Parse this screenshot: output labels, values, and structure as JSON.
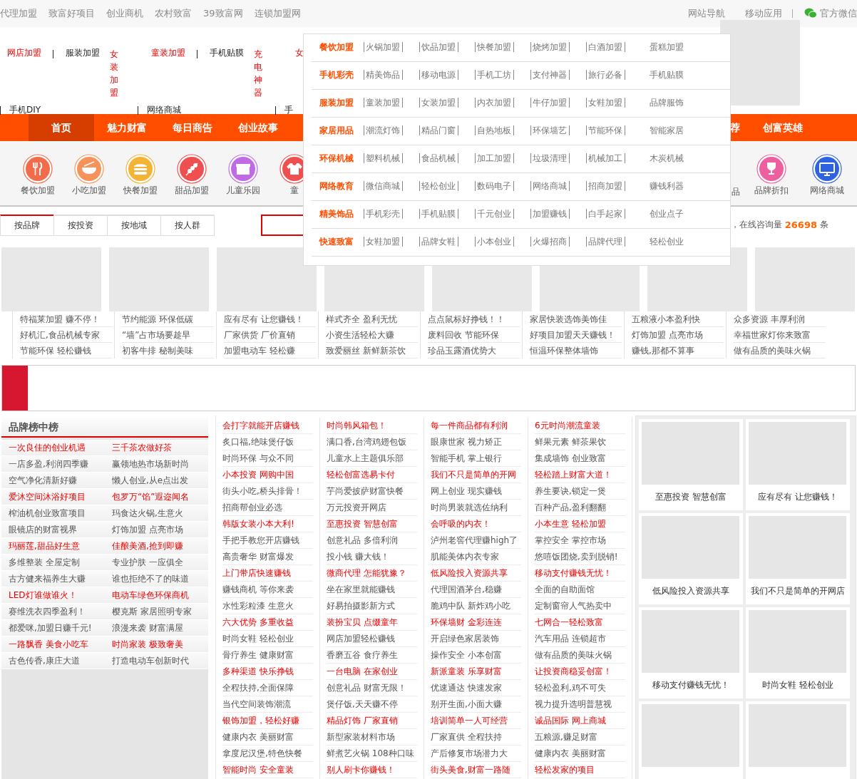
{
  "top_bar": {
    "links": [
      "代理加盟",
      "致富好项目",
      "创业商机",
      "农村致富",
      "39致富网",
      "连锁加盟网"
    ],
    "right_links": [
      "网站导航",
      "移动应用"
    ],
    "wechat": "官方微信"
  },
  "header": {
    "row1": [
      {
        "label": "网店加盟",
        "highlighted": true,
        "kind": "text",
        "divider_before": false
      },
      {
        "label": "服装加盟",
        "highlighted": false,
        "kind": "text",
        "divider_before": true
      },
      {
        "label": "女装加盟",
        "highlighted": true,
        "kind": "vertical",
        "divider_before": false
      },
      {
        "label": "童装加盟",
        "highlighted": true,
        "kind": "text",
        "divider_before": false
      },
      {
        "label": "手机贴膜",
        "highlighted": false,
        "kind": "text",
        "divider_before": true
      },
      {
        "label": "充电神器",
        "highlighted": true,
        "kind": "vertical",
        "divider_before": false
      },
      {
        "label": "女",
        "highlighted": true,
        "kind": "text",
        "divider_before": false
      }
    ],
    "row2": [
      "手机DIY",
      "网络商城",
      "手"
    ]
  },
  "nav": {
    "left": [
      {
        "label": "首页",
        "selected": true
      },
      {
        "label": "魅力财富",
        "selected": false
      },
      {
        "label": "每日商告",
        "selected": false
      },
      {
        "label": "创业故事",
        "selected": false
      }
    ],
    "right": [
      {
        "label": "荐",
        "selected": false
      },
      {
        "label": "创富英雄",
        "selected": false
      }
    ]
  },
  "category_icons": {
    "left": [
      {
        "label": "餐饮加盟",
        "color": "#f26b4a"
      },
      {
        "label": "小吃加盟",
        "color": "#f7935a"
      },
      {
        "label": "快餐加盟",
        "color": "#f5b335"
      },
      {
        "label": "甜品加盟",
        "color": "#ef4f4f"
      },
      {
        "label": "儿童乐园",
        "color": "#c06ae6"
      },
      {
        "label": "童",
        "color": "#ef4f4f"
      }
    ],
    "right": [
      {
        "label": "品"
      },
      {
        "label": "品牌折扣",
        "color": "#ee5fa0"
      },
      {
        "label": "网络商城",
        "color": "#2f62e0"
      }
    ]
  },
  "dropdown": {
    "rows": [
      {
        "title": "餐饮加盟",
        "items": [
          "火锅加盟",
          "饮品加盟",
          "快餐加盟",
          "烧烤加盟",
          "白酒加盟",
          "蛋糕加盟"
        ]
      },
      {
        "title": "手机彩壳",
        "items": [
          "精美饰品",
          "移动电源",
          "手机工坊",
          "支付神器",
          "旅行必备",
          "手机贴膜"
        ]
      },
      {
        "title": "服装加盟",
        "items": [
          "童装加盟",
          "女装加盟",
          "内衣加盟",
          "牛仔加盟",
          "女鞋加盟",
          "品牌服饰"
        ]
      },
      {
        "title": "家居用品",
        "items": [
          "潮流灯饰",
          "精品门窗",
          "自热地板",
          "环保墙艺",
          "节能环保",
          "智能家居"
        ]
      },
      {
        "title": "环保机械",
        "items": [
          "塑料机械",
          "食品机械",
          "加工加盟",
          "垃圾清理",
          "机械加工",
          "木炭机械"
        ]
      },
      {
        "title": "网络教育",
        "items": [
          "微信商城",
          "轻松创业",
          "数码电子",
          "网络商城",
          "招商加盟",
          "赚钱利器"
        ]
      },
      {
        "title": "精美饰品",
        "items": [
          "手机彩壳",
          "手机贴膜",
          "千元创业",
          "加盟赚钱",
          "白手起家",
          "创业点子"
        ]
      },
      {
        "title": "快速致富",
        "items": [
          "女鞋加盟",
          "品牌女鞋",
          "小本创业",
          "火爆招商",
          "品牌代理",
          "轻松创业"
        ]
      }
    ]
  },
  "search_tabs": {
    "tabs": [
      {
        "label": "按品牌",
        "selected": true
      },
      {
        "label": "按投资",
        "selected": false
      },
      {
        "label": "按地域",
        "selected": false
      },
      {
        "label": "按人群",
        "selected": false
      }
    ],
    "stats": {
      "label": "，在线咨询量",
      "count": "26698",
      "unit": "条"
    }
  },
  "ads": [
    {
      "lines": [
        "特福莱加盟 赚不停！",
        "好机汇,食品机械专家",
        "节能环保 轻松赚钱"
      ]
    },
    {
      "lines": [
        "节约能源 环保低碳",
        "“墙”占市场要趁早",
        "初客牛排 秘制美味"
      ]
    },
    {
      "lines": [
        "应有尽有 让您赚钱！",
        "厂家供货 厂价直销",
        "加盟电动车 轻松赚"
      ]
    },
    {
      "lines": [
        "样式齐全 盈利无忧",
        "小资生活轻松大赚",
        "致爱丽丝 新鲜新茶饮"
      ]
    },
    {
      "lines": [
        "点点鼠标好挣钱！！",
        "废料回收 节能环保",
        "珍品玉露酒优势大"
      ]
    },
    {
      "lines": [
        "家居快装选饰美饰佳",
        "好项目加盟天天赚钱！",
        "恒温环保整体墙饰"
      ]
    },
    {
      "lines": [
        "五粮液小本盈利快",
        "灯饰加盟 点亮市场",
        "赚钱,那都不算事"
      ]
    },
    {
      "lines": [
        "众多资源 丰厚利润",
        "幸福世家灯你来致富",
        "做有品质的美味火锅"
      ]
    }
  ],
  "ranking": {
    "title": "**品牌**榜中榜",
    "rows": [
      {
        "highlighted": true,
        "cells": [
          "一次良佳的创业机遇",
          "三千茶农做好茶"
        ]
      },
      {
        "highlighted": false,
        "cells": [
          "一店多盈,利润四季赚",
          "赢领地热市场新时尚"
        ]
      },
      {
        "highlighted": false,
        "cells": [
          "空气净化清新好赚",
          "懒人创业,从e点出发"
        ]
      },
      {
        "highlighted": true,
        "cells": [
          "爱沐空间沐浴好项目",
          "包罗万“馅”遐迩闻名"
        ]
      },
      {
        "highlighted": false,
        "cells": [
          "榨油机创业致富项目",
          "玛食达火锅,生意火"
        ]
      },
      {
        "highlighted": false,
        "cells": [
          "眼镜店的财富视界",
          "灯饰加盟 点亮市场"
        ]
      },
      {
        "highlighted": true,
        "cells": [
          "玛丽莲,甜品好生意",
          "佳酿美酒,抢到即赚"
        ]
      },
      {
        "highlighted": false,
        "cells": [
          "多维整装 全屋定制",
          "专业护肤 一应俱全"
        ]
      },
      {
        "highlighted": false,
        "cells": [
          "古方健来福养生大赚",
          "谁也拒绝不了的味道"
        ]
      },
      {
        "highlighted": true,
        "cells": [
          "LED灯谁做谁火！",
          "电动车绿色环保商机"
        ]
      },
      {
        "highlighted": false,
        "cells": [
          "赛维洗衣四季盈利！",
          "樱克斯 家居照明专家"
        ]
      },
      {
        "highlighted": false,
        "cells": [
          "都爱咪,加盟日赚千元!",
          "浪漫来袭 财富满屋"
        ]
      },
      {
        "highlighted": true,
        "cells": [
          "一路飘香 美食小吃车",
          "时尚家装 极致奢美"
        ]
      },
      {
        "highlighted": false,
        "cells": [
          "古色传香,康庄大道",
          "打造电动车创新时代"
        ]
      }
    ]
  },
  "columns": [
    {
      "lines": [
        {
          "text": "会打字就能开店赚钱",
          "highlighted": true
        },
        {
          "text": "炙口福,绝味煲仔饭",
          "highlighted": false
        },
        {
          "text": "时尚环保 与众不同",
          "highlighted": false
        },
        {
          "text": "小本投资 网购中国",
          "highlighted": true
        },
        {
          "text": "街头小吃,桥头排骨！",
          "highlighted": false
        },
        {
          "text": "招商帮创业必选",
          "highlighted": false
        },
        {
          "text": "韩版女装小本大利!",
          "highlighted": true
        },
        {
          "text": "手把手教您开店赚钱",
          "highlighted": false
        },
        {
          "text": "高贵奢华 财富爆发",
          "highlighted": false
        },
        {
          "text": "上门带店快速赚钱",
          "highlighted": true
        },
        {
          "text": "赚钱商机 等你来袭",
          "highlighted": false
        },
        {
          "text": "水性彩粒漆 生意火",
          "highlighted": false
        },
        {
          "text": "六大优势 多重收益",
          "highlighted": true
        },
        {
          "text": "时尚女鞋 轻松创业",
          "highlighted": false
        },
        {
          "text": "骨疗养生 健康财富",
          "highlighted": false
        },
        {
          "text": "多种渠道 快乐挣钱",
          "highlighted": true
        },
        {
          "text": "全程扶持,全面保障",
          "highlighted": false
        },
        {
          "text": "当代空间装饰潮流",
          "highlighted": false
        },
        {
          "text": "银饰加盟，轻松好赚",
          "highlighted": true
        },
        {
          "text": "健康内衣 美丽财富",
          "highlighted": false
        },
        {
          "text": "拿度尼汉堡,特色快餐",
          "highlighted": false
        },
        {
          "text": "智能时尚 安全童装",
          "highlighted": true
        }
      ]
    },
    {
      "lines": [
        {
          "text": "时尚韩风箱包！",
          "highlighted": true
        },
        {
          "text": "满口香,台湾鸡翅包饭",
          "highlighted": false
        },
        {
          "text": "儿童水上主题俱乐部",
          "highlighted": false
        },
        {
          "text": "轻松创富选易卡付",
          "highlighted": true
        },
        {
          "text": "芋尚爱披萨财富快餐",
          "highlighted": false
        },
        {
          "text": "万元投资开网店",
          "highlighted": false
        },
        {
          "text": "至惠投资 智慧创富",
          "highlighted": true
        },
        {
          "text": "创意礼品 多倍利润",
          "highlighted": false
        },
        {
          "text": "投小钱 赚大钱！",
          "highlighted": false
        },
        {
          "text": "微商代理 怎能犹豫？",
          "highlighted": true
        },
        {
          "text": "坐在家里就能赚钱",
          "highlighted": false
        },
        {
          "text": "好易拍摄影新方式",
          "highlighted": false
        },
        {
          "text": "装扮宝贝 点缀童年",
          "highlighted": true
        },
        {
          "text": "网店加盟轻松赚钱",
          "highlighted": false
        },
        {
          "text": "香磨五谷 食疗养生",
          "highlighted": false
        },
        {
          "text": "一台电脑 在家创业",
          "highlighted": true
        },
        {
          "text": "创意礼品 财富无限！",
          "highlighted": false
        },
        {
          "text": "煲仔饭,天天赚不停",
          "highlighted": false
        },
        {
          "text": "精品灯饰 厂家直销",
          "highlighted": true
        },
        {
          "text": "新型家装材料市场",
          "highlighted": false
        },
        {
          "text": "鲜煮艺火锅 108种口味",
          "highlighted": false
        },
        {
          "text": "别人刷卡你赚钱！",
          "highlighted": true
        }
      ]
    },
    {
      "lines": [
        {
          "text": "每一件商品都有利润",
          "highlighted": true
        },
        {
          "text": "眼康世家 视力矫正",
          "highlighted": false
        },
        {
          "text": "智能手机 掌上银行",
          "highlighted": false
        },
        {
          "text": "我们不只是简单的开网",
          "highlighted": true
        },
        {
          "text": "网上创业 现实赚钱",
          "highlighted": false
        },
        {
          "text": "时尚男装就选佐纳利",
          "highlighted": false
        },
        {
          "text": "会呼吸的内衣！",
          "highlighted": true
        },
        {
          "text": "泸州老窖代理赚high了",
          "highlighted": false
        },
        {
          "text": "肌能美体内衣专家",
          "highlighted": false
        },
        {
          "text": "低风险投入资源共享",
          "highlighted": true
        },
        {
          "text": "代理国酒茅台,稳赚",
          "highlighted": false
        },
        {
          "text": "脆鸡中队 新炸鸡小吃",
          "highlighted": false
        },
        {
          "text": "环保墙财 金彩连连",
          "highlighted": true
        },
        {
          "text": "开启绿色家居装饰",
          "highlighted": false
        },
        {
          "text": "操作安全 小本创富",
          "highlighted": false
        },
        {
          "text": "新派童装 乐享财富",
          "highlighted": true
        },
        {
          "text": "优速通达 快速发家",
          "highlighted": false
        },
        {
          "text": "别开生面,小面大赚",
          "highlighted": false
        },
        {
          "text": "培训简单一人可经营",
          "highlighted": true
        },
        {
          "text": "厂家直供 全程扶持",
          "highlighted": false
        },
        {
          "text": "产后修复市场潜力大",
          "highlighted": false
        },
        {
          "text": "街头美食,财富一路随",
          "highlighted": true
        }
      ]
    },
    {
      "lines": [
        {
          "text": "6元时尚潮流童装",
          "highlighted": true
        },
        {
          "text": "鲜果元素 鲜茶果饮",
          "highlighted": false
        },
        {
          "text": "集成墙饰 创业致富",
          "highlighted": false
        },
        {
          "text": "轻松踏上财富大道！",
          "highlighted": true
        },
        {
          "text": "养生要诀,锁定一煲",
          "highlighted": false
        },
        {
          "text": "百种产品,盈利翻翻",
          "highlighted": false
        },
        {
          "text": "小本生意 轻松加盟",
          "highlighted": true
        },
        {
          "text": "掌控安全 掌控市场",
          "highlighted": false
        },
        {
          "text": "悠嘻饭团烧,卖到脱销!",
          "highlighted": false
        },
        {
          "text": "移动支付赚钱无忧！",
          "highlighted": true
        },
        {
          "text": "全面的自助面馆",
          "highlighted": false
        },
        {
          "text": "定制窗帘人气热卖中",
          "highlighted": false
        },
        {
          "text": "七网合一轻松致富",
          "highlighted": true
        },
        {
          "text": "汽车用品 连锁超市",
          "highlighted": false
        },
        {
          "text": "做有品质的美味火锅",
          "highlighted": false
        },
        {
          "text": "让投资商稳妥创富！",
          "highlighted": true
        },
        {
          "text": "轻松盈利,鸡不可失",
          "highlighted": false
        },
        {
          "text": "视力提升选明普慧视",
          "highlighted": false
        },
        {
          "text": "诚品国际 网上商城",
          "highlighted": true
        },
        {
          "text": "五粮源,赚足财富",
          "highlighted": false
        },
        {
          "text": "健康内衣 美丽财富",
          "highlighted": false
        },
        {
          "text": "轻松发家的项目",
          "highlighted": true
        }
      ]
    }
  ],
  "showcase": [
    {
      "kind": "captioned",
      "caption": "至惠投资 智慧创富"
    },
    {
      "kind": "captioned",
      "caption": "应有尽有 让您赚钱！"
    },
    {
      "kind": "captioned",
      "caption": "低风险投入资源共享"
    },
    {
      "kind": "captioned",
      "caption": "我们不只是简单的开网店"
    },
    {
      "kind": "captioned",
      "caption": "移动支付赚钱无忧！"
    },
    {
      "kind": "captioned",
      "caption": "时尚女鞋 轻松创业"
    },
    {
      "kind": "image_only"
    },
    {
      "kind": "image_only"
    }
  ]
}
